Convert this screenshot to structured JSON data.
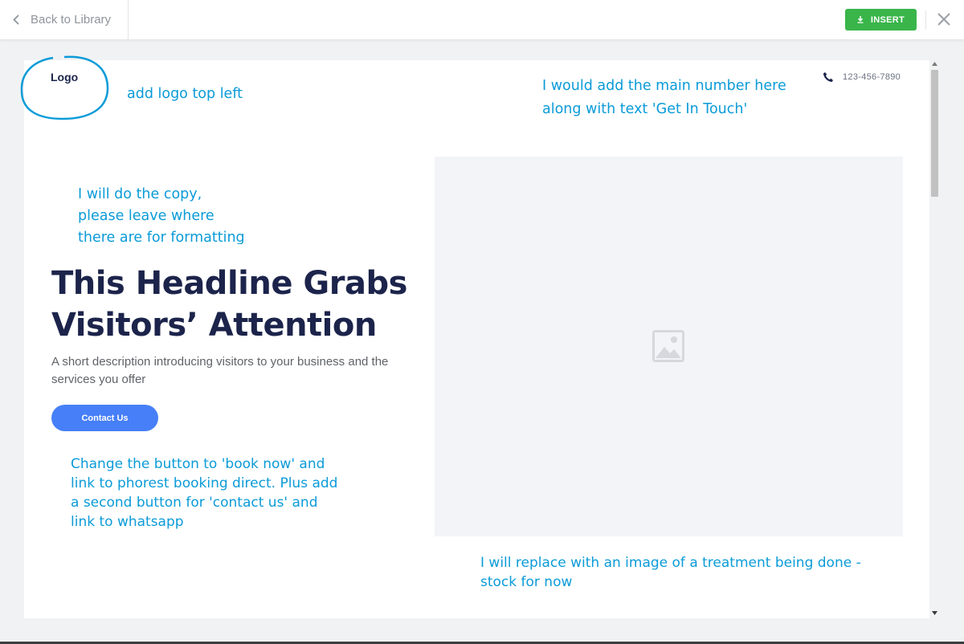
{
  "topbar": {
    "back_label": "Back to Library",
    "insert_label": "INSERT",
    "accent_color": "#39b54a"
  },
  "template": {
    "logo_text": "Logo",
    "phone": "123-456-7890",
    "headline": "This Headline Grabs Visitors’ Attention",
    "description": "A short description introducing visitors to your business and the services you offer",
    "cta_label": "Contact Us",
    "cta_color": "#467ff7"
  },
  "annotations": {
    "logo": "add logo top left",
    "phone_line1": "I would add the main number here",
    "phone_line2": "along with text 'Get In Touch'",
    "copy_line1": "I will do the copy,",
    "copy_line2": "please leave where",
    "copy_line3": "there are for formatting",
    "button_line1": "Change the button to 'book now' and",
    "button_line2": "link to phorest booking direct. Plus add",
    "button_line3": "a second button for 'contact us' and",
    "button_line4": "link to whatsapp",
    "image_line1": "I will replace with an image of a treatment being done -",
    "image_line2": "stock for now",
    "color": "#0b9bd8"
  },
  "icons": [
    "chevron-left-icon",
    "download-icon",
    "close-icon",
    "phone-icon",
    "image-placeholder-icon"
  ]
}
